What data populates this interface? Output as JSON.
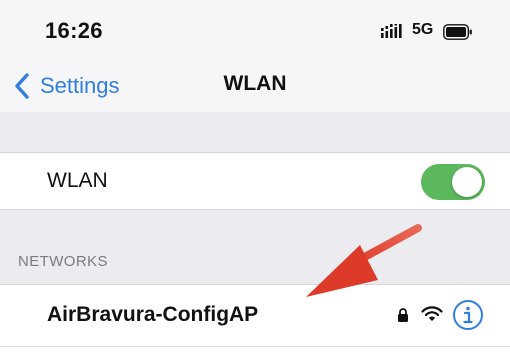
{
  "status_bar": {
    "time": "16:26",
    "network_type": "5G"
  },
  "nav": {
    "back_label": "Settings",
    "title": "WLAN"
  },
  "wlan_toggle": {
    "label": "WLAN",
    "state": "on",
    "color": "#5cb85c"
  },
  "networks_section": {
    "header": "NETWORKS",
    "items": [
      {
        "name": "AirBravura-ConfigAP",
        "secured": true,
        "icons": [
          "lock-icon",
          "wifi-icon",
          "info-icon"
        ]
      }
    ]
  },
  "annotation": {
    "type": "red-arrow",
    "color": "#e0402f"
  },
  "colors": {
    "accent_blue": "#2f7ee0",
    "toggle_green": "#5cb85c"
  }
}
